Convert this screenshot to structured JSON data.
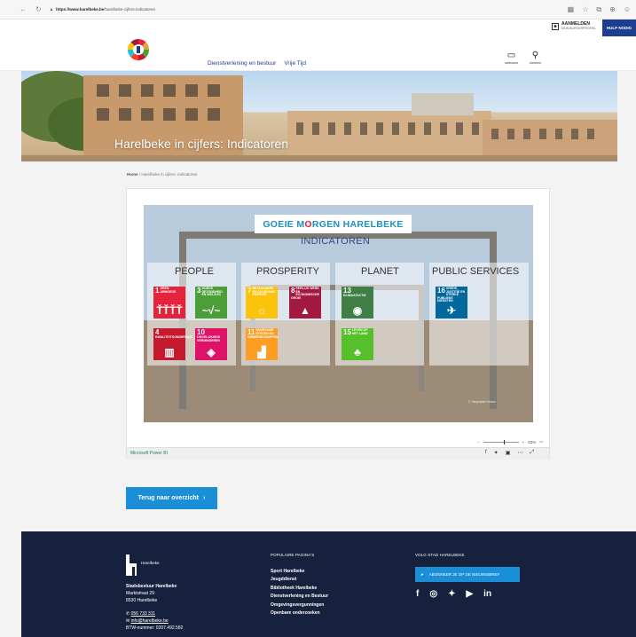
{
  "browser": {
    "url_host": "https://www.harelbeke.be",
    "url_path": "/harelbeke-cijfers-indicatoren"
  },
  "util": {
    "login_title": "AANMELDEN",
    "login_sub": "MIJN BURGERPROFIEL",
    "help": "HULP NODIG"
  },
  "nav": {
    "items": [
      "Dienstverlening en bestuur",
      "Vrije Tijd"
    ],
    "webcam": "webcam",
    "search": "zoeken"
  },
  "hero": {
    "title": "Harelbeke in cijfers: Indicatoren"
  },
  "breadcrumb": {
    "home": "Home",
    "separator": "/",
    "current": "Harelbeke in cijfers: Indicatoren"
  },
  "report": {
    "banner_part1": "GOEIE M",
    "banner_o": "O",
    "banner_part2": "RGEN HARELBEKE",
    "subtitle": "INDICATOREN",
    "columns": [
      "PEOPLE",
      "PROSPERITY",
      "PLANET",
      "PUBLIC SERVICES"
    ],
    "tiles": [
      {
        "num": "1",
        "label": "GEEN ARMOEDE",
        "icon": "ŤŤŤŤ",
        "color": "#e5243b"
      },
      {
        "num": "3",
        "label": "GOEDE GEZONDHEID EN WELZIJN",
        "icon": "~√~",
        "color": "#4c9f38"
      },
      {
        "num": "7",
        "label": "BETAALBARE EN DUURZAME ENERGIE",
        "icon": "☼",
        "color": "#fcc30b"
      },
      {
        "num": "8",
        "label": "EERLIJK WERK EN ECONOMISCHE GROEI",
        "icon": "▲",
        "color": "#a21942"
      },
      {
        "num": "13",
        "label": "KLIMAATACTIE",
        "icon": "◉",
        "color": "#3f7e44"
      },
      {
        "num": "16",
        "label": "VREDE, JUSTITIE EN STERKE PUBLIEKE DIENSTEN",
        "icon": "✈",
        "color": "#00689d"
      },
      {
        "num": "4",
        "label": "KWALITEITSONDERWIJS",
        "icon": "▥",
        "color": "#c5192d"
      },
      {
        "num": "10",
        "label": "ONGELIJKHEID VERMINDEREN",
        "icon": "◈",
        "color": "#dd1367"
      },
      {
        "num": "11",
        "label": "DUURZAME STEDEN EN GEMEENSCHAPPEN",
        "icon": "▟",
        "color": "#fd9d24"
      },
      {
        "num": "15",
        "label": "LEVEN OP HET LAND",
        "icon": "♣",
        "color": "#56c02b"
      }
    ],
    "credit": "© Stephanie Defoor",
    "zoom": "83%",
    "powerbi_link": "Microsoft Power BI"
  },
  "back_button": {
    "label": "Terug naar overzicht",
    "arrow": "›"
  },
  "footer": {
    "brand": "Harelbeke",
    "org": "Stadsbestuur Harelbeke",
    "street": "Marktstraat 29",
    "city": "8530 Harelbeke",
    "phone": "056 733 311",
    "email": "info@harelbeke.be",
    "vat": "BTW-nummer: 0207.492.582",
    "popular_title": "POPULAIRE PAGINA'S",
    "popular": [
      "Sport Harelbeke",
      "Jeugddienst",
      "Bibliotheek Harelbeke",
      "Dienstverlening en Bestuur",
      "Omgevingsvergunningen",
      "Openbare onderzoeken"
    ],
    "follow_title": "VOLG STAD HARELBEKE",
    "subscribe": "ABONNEER JE OP DE NIEUWSBRIEF"
  }
}
